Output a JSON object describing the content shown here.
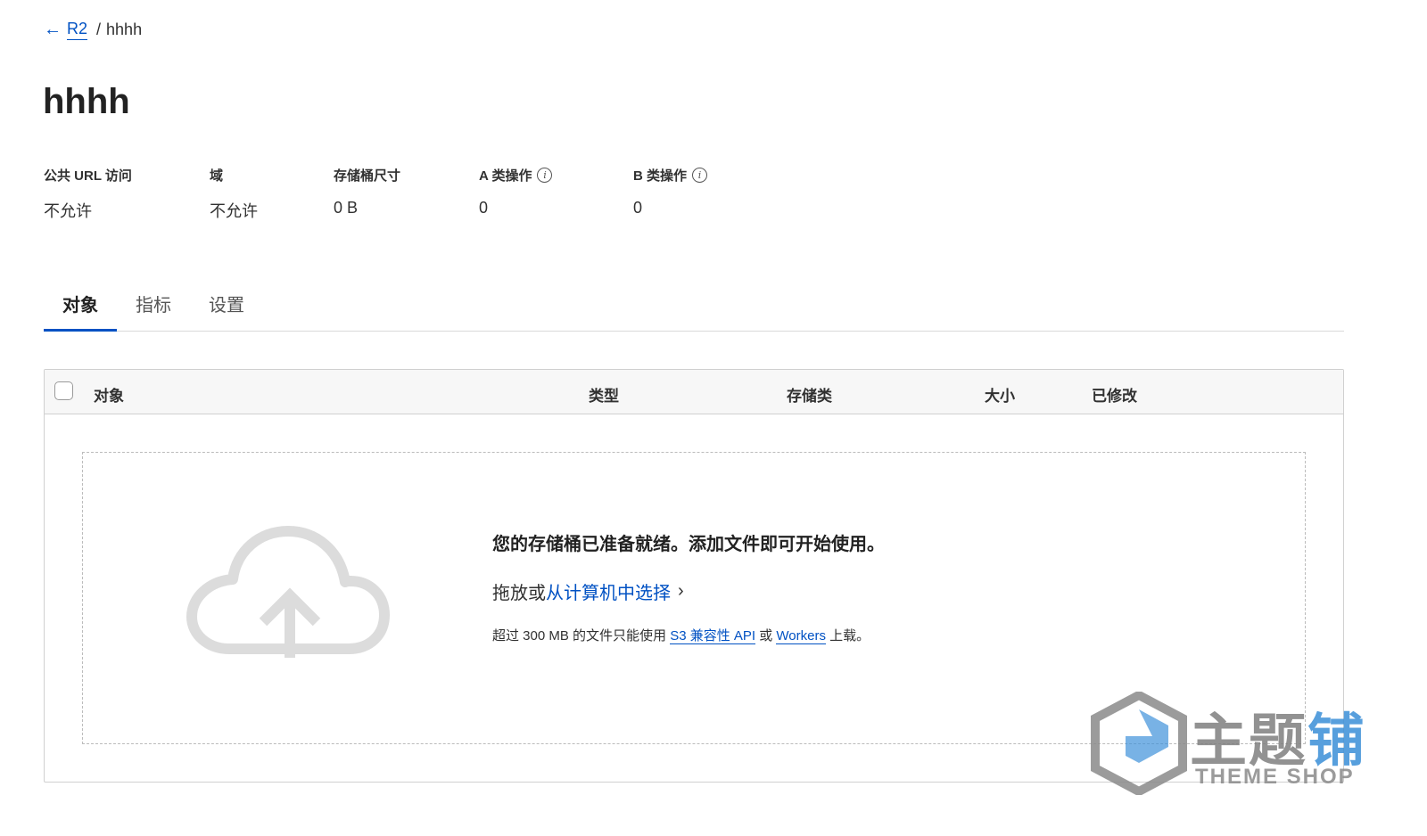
{
  "breadcrumb": {
    "back_link": "R2",
    "separator": "/",
    "current": "hhhh"
  },
  "page_title": "hhhh",
  "stats": [
    {
      "label": "公共 URL 访问",
      "value": "不允许",
      "info": false
    },
    {
      "label": "域",
      "value": "不允许",
      "info": false
    },
    {
      "label": "存储桶尺寸",
      "value": "0 B",
      "info": false
    },
    {
      "label": "A 类操作",
      "value": "0",
      "info": true
    },
    {
      "label": "B 类操作",
      "value": "0",
      "info": true
    }
  ],
  "tabs": [
    {
      "label": "对象",
      "active": true
    },
    {
      "label": "指标",
      "active": false
    },
    {
      "label": "设置",
      "active": false
    }
  ],
  "table": {
    "columns": [
      "对象",
      "类型",
      "存储类",
      "大小",
      "已修改"
    ]
  },
  "dropzone": {
    "title": "您的存储桶已准备就绪。添加文件即可开始使用。",
    "drag_text": "拖放或",
    "select_link": "从计算机中选择",
    "note_prefix": "超过 300 MB 的文件只能使用 ",
    "s3_link": "S3 兼容性 API",
    "note_or": " 或 ",
    "workers_link": "Workers",
    "note_suffix": " 上载。"
  },
  "watermark": {
    "cn": "主题",
    "cn_accent": "铺",
    "en": "THEME SHOP"
  },
  "colors": {
    "accent": "#0051c3",
    "text": "#313131",
    "border": "#d0d0d0"
  },
  "icons": [
    "arrow-left-icon",
    "info-icon",
    "checkbox",
    "cloud-upload-icon",
    "chevron-right-icon"
  ]
}
